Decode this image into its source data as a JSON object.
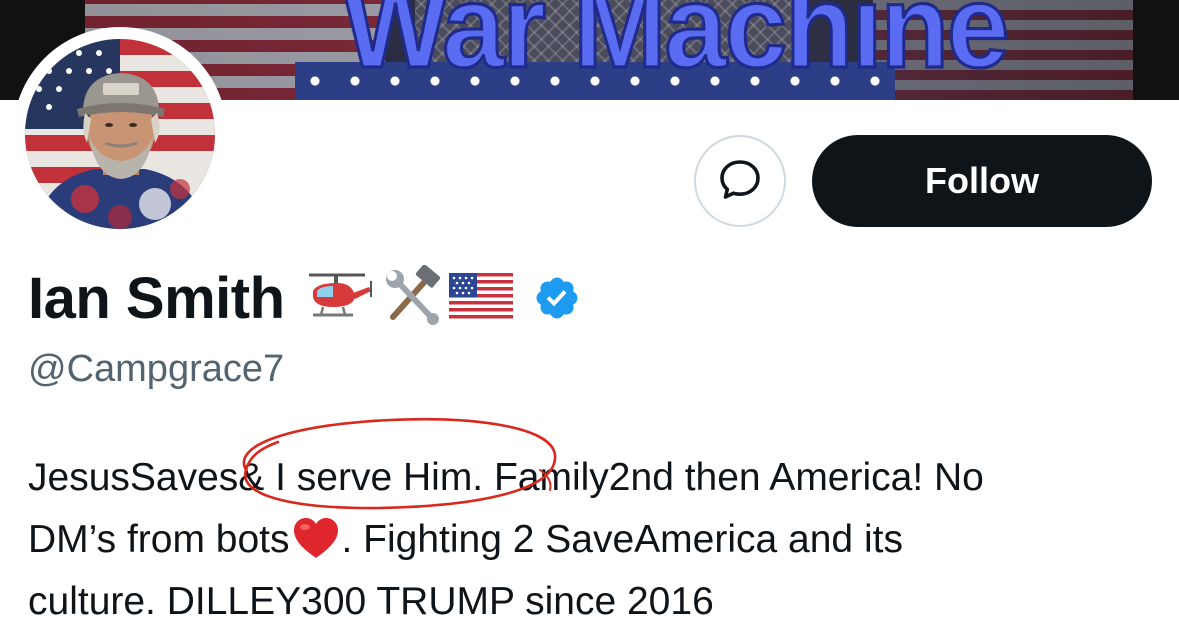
{
  "banner": {
    "title": "War Machine"
  },
  "profile": {
    "display_name": "Ian Smith",
    "name_emojis": [
      "helicopter-emoji",
      "hammer-and-wrench-emoji",
      "us-flag-emoji"
    ],
    "verified": true,
    "handle": "@Campgrace7"
  },
  "actions": {
    "message_icon": "speech-bubble-icon",
    "follow_label": "Follow"
  },
  "bio": {
    "line1": "JesusSaves& I serve Him. Family2nd then America! No",
    "line2_before_heart": "DM’s from bots",
    "line2_after_heart": ". Fighting 2 SaveAmerica and its",
    "line3": "culture. DILLEY300 TRUMP since 2016"
  },
  "colors": {
    "follow_bg": "#0f1419",
    "handle_gray": "#536471",
    "verified_blue": "#1d9bf0",
    "annotation_red": "#d8291e",
    "banner_title_blue": "#5a6cf2"
  }
}
